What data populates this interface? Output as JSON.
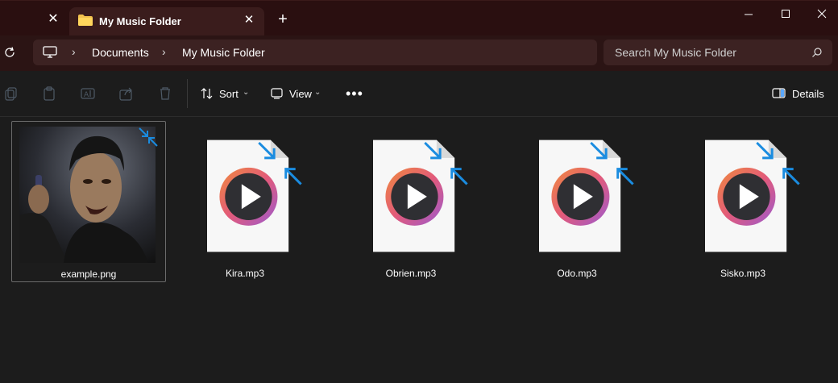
{
  "window": {
    "tab_title": "My Music Folder",
    "tab_icon": "folder-icon"
  },
  "address": {
    "crumbs": [
      "Documents",
      "My Music Folder"
    ]
  },
  "search": {
    "placeholder": "Search My Music Folder"
  },
  "toolbar": {
    "sort_label": "Sort",
    "view_label": "View",
    "details_label": "Details"
  },
  "files": [
    {
      "name": "example.png",
      "type": "image",
      "selected": true
    },
    {
      "name": "Kira.mp3",
      "type": "audio"
    },
    {
      "name": "Obrien.mp3",
      "type": "audio"
    },
    {
      "name": "Odo.mp3",
      "type": "audio"
    },
    {
      "name": "Sisko.mp3",
      "type": "audio"
    }
  ],
  "colors": {
    "titlebar": "#2a0f10",
    "address_bg": "#3c2222",
    "content_bg": "#1c1c1c",
    "accent_arrow": "#1a8ce0"
  }
}
